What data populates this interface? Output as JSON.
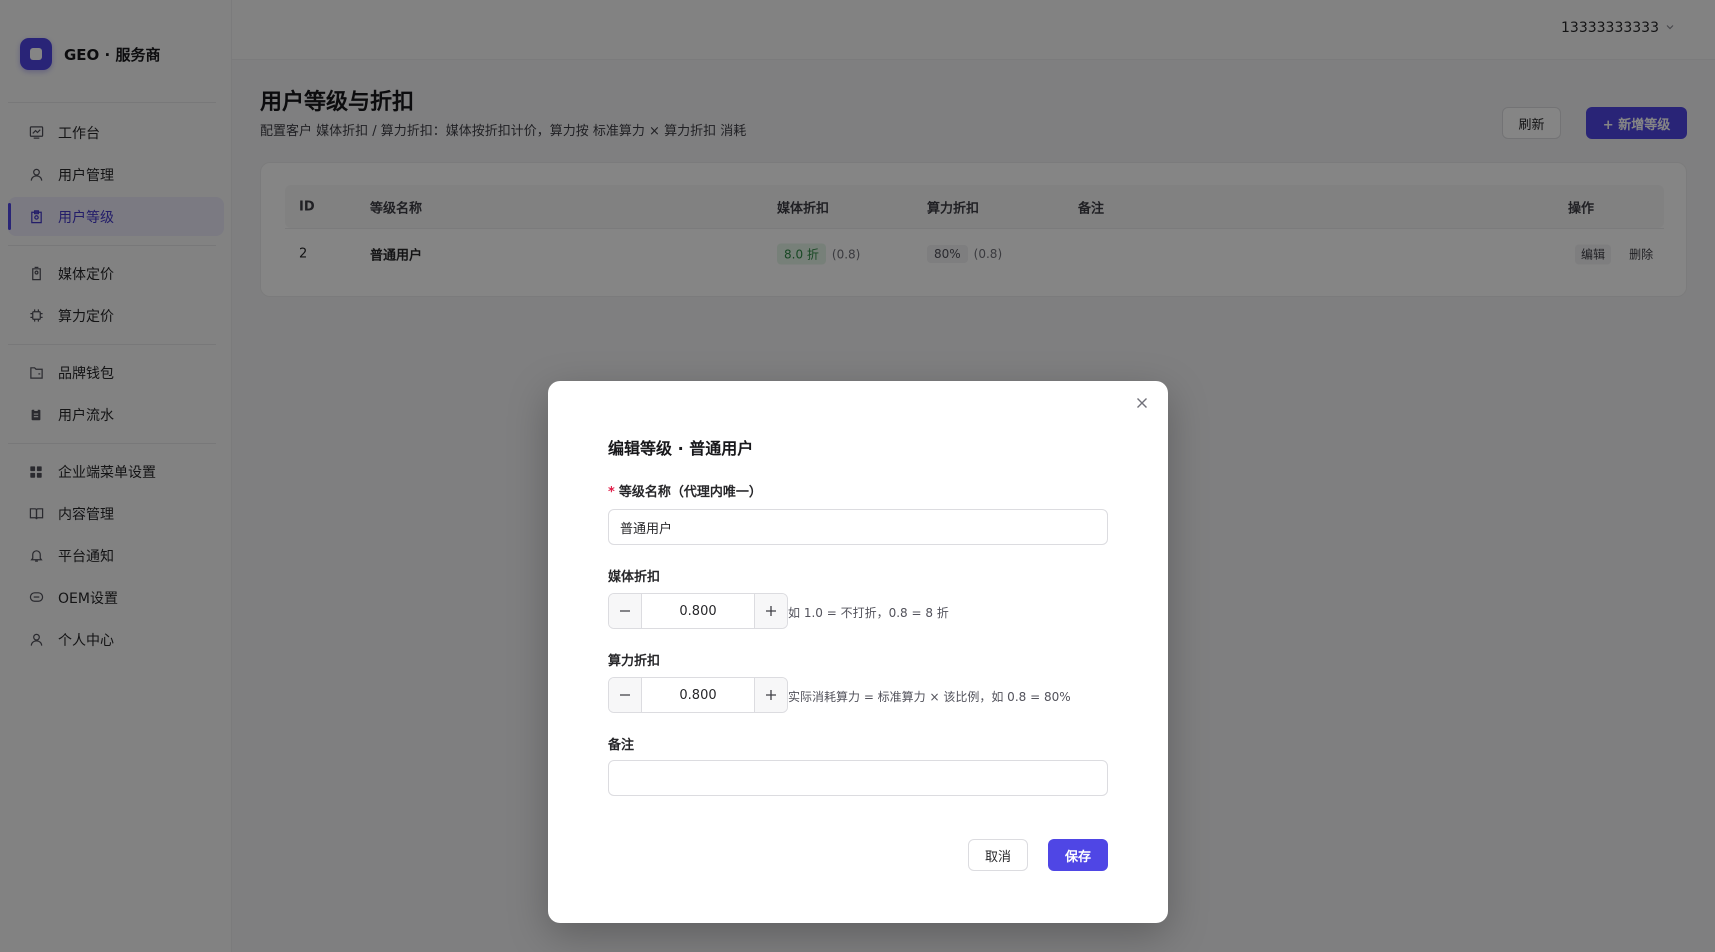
{
  "brand": {
    "name": "GEO · 服务商"
  },
  "header": {
    "user": "13333333333"
  },
  "sidebar": {
    "items": [
      {
        "label": "工作台",
        "icon": "dashboard-icon"
      },
      {
        "label": "用户管理",
        "icon": "user-icon"
      },
      {
        "label": "用户等级",
        "icon": "level-icon",
        "active": true
      },
      {
        "label": "媒体定价",
        "icon": "tag-icon"
      },
      {
        "label": "算力定价",
        "icon": "chip-icon"
      },
      {
        "label": "品牌钱包",
        "icon": "folder-icon"
      },
      {
        "label": "用户流水",
        "icon": "clipboard-icon"
      },
      {
        "label": "企业端菜单设置",
        "icon": "grid-icon"
      },
      {
        "label": "内容管理",
        "icon": "book-icon"
      },
      {
        "label": "平台通知",
        "icon": "bell-icon"
      },
      {
        "label": "OEM设置",
        "icon": "cloud-icon"
      },
      {
        "label": "个人中心",
        "icon": "user-icon"
      }
    ]
  },
  "main": {
    "title": "用户等级与折扣",
    "description": "配置客户 媒体折扣 / 算力折扣：媒体按折扣计价，算力按 标准算力 × 算力折扣 消耗",
    "refresh_label": "刷新",
    "add_label": "+ 新增等级",
    "table": {
      "columns": [
        "ID",
        "等级名称",
        "媒体折扣",
        "算力折扣",
        "备注",
        "操作"
      ],
      "rows": [
        {
          "id": "2",
          "name": "普通用户",
          "media_badge": "8.0 折",
          "media_value": "(0.8)",
          "compute_badge": "80%",
          "compute_value": "(0.8)",
          "note": "",
          "actions": [
            "编辑",
            "删除"
          ]
        }
      ]
    }
  },
  "modal": {
    "title": "编辑等级 · 普通用户",
    "name_label": "等级名称（代理内唯一）",
    "name_value": "普通用户",
    "media_label": "媒体折扣",
    "media_value": "0.800",
    "media_hint": "如 1.0 = 不打折，0.8 = 8 折",
    "compute_label": "算力折扣",
    "compute_value": "0.800",
    "compute_hint": "实际消耗算力 = 标准算力 × 该比例，如 0.8 = 80%",
    "note_label": "备注",
    "note_value": "",
    "cancel_label": "取消",
    "save_label": "保存"
  },
  "colors": {
    "accent": "#4f46e5",
    "success_bg": "#e5f5e9",
    "success_text": "#2f8a45"
  }
}
